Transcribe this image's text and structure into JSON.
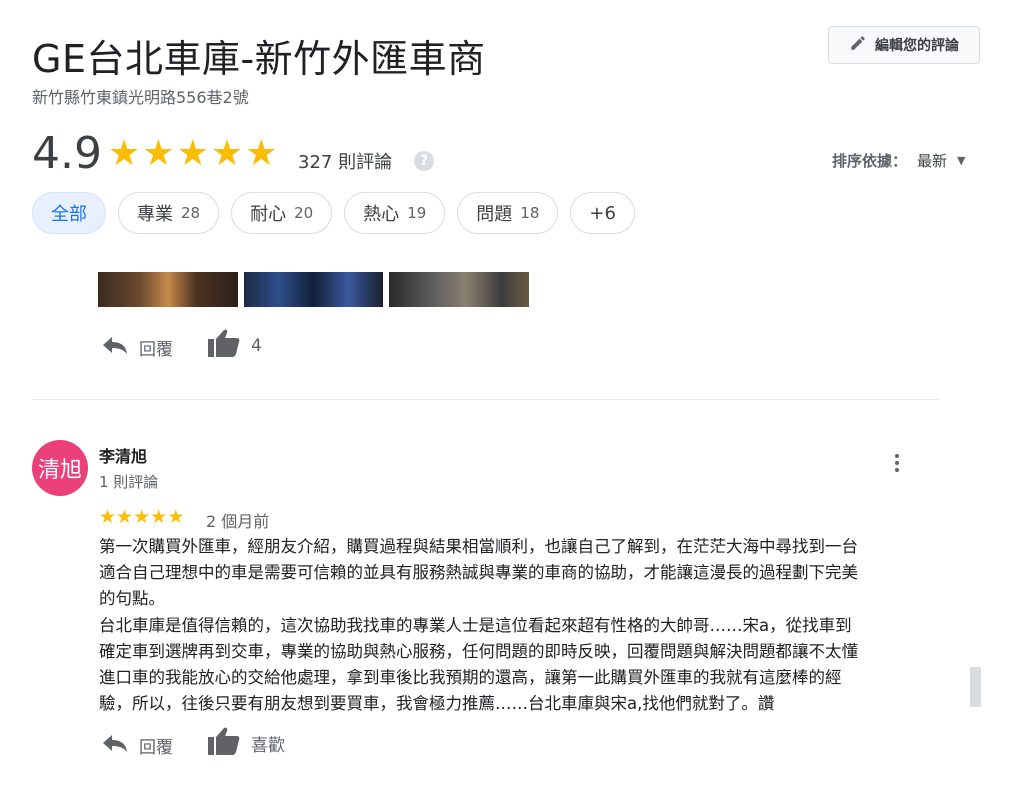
{
  "place": {
    "title": "GE台北車庫-新竹外匯車商",
    "address": "新竹縣竹東鎮光明路556巷2號",
    "edit_review_label": "編輯您的評論"
  },
  "summary": {
    "rating": "4.9",
    "star_count": 5,
    "review_count": "327 則評論",
    "help_glyph": "?"
  },
  "sort": {
    "label": "排序依據：",
    "value": "最新"
  },
  "filters": [
    {
      "label": "全部",
      "count": ""
    },
    {
      "label": "專業",
      "count": "28"
    },
    {
      "label": "耐心",
      "count": "20"
    },
    {
      "label": "熱心",
      "count": "19"
    },
    {
      "label": "問題",
      "count": "18"
    },
    {
      "label": "+6",
      "count": ""
    }
  ],
  "previous_review": {
    "reply_label": "回覆",
    "like_count": "4"
  },
  "review": {
    "avatar_text": "清旭",
    "avatar_color": "#ec407a",
    "name": "李清旭",
    "sub": "1 則評論",
    "rating": 5,
    "time": "2 個月前",
    "text": "第一次購買外匯車，經朋友介紹，購買過程與結果相當順利，也讓自己了解到，在茫茫大海中尋找到一台\n適合自己理想中的車是需要可信賴的並具有服務熱誠與專業的車商的協助，才能讓這漫長的過程劃下完美\n的句點。\n台北車庫是值得信賴的，這次協助我找車的專業人士是這位看起來超有性格的大帥哥……宋a，從找車到\n確定車到選牌再到交車，專業的協助與熱心服務，任何問題的即時反映，回覆問題與解決問題都讓不太懂\n進口車的我能放心的交給他處理，拿到車後比我預期的還高，讓第一此購買外匯車的我就有這麼棒的經\n驗，所以，往後只要有朋友想到要買車，我會極力推薦……台北車庫與宋a,找他們就對了。讚",
    "reply_label": "回覆",
    "like_label": "喜歡"
  },
  "colors": {
    "star": "#fbbc04",
    "active_chip_bg": "#e8f0fe",
    "active_chip_text": "#1a73e8"
  }
}
